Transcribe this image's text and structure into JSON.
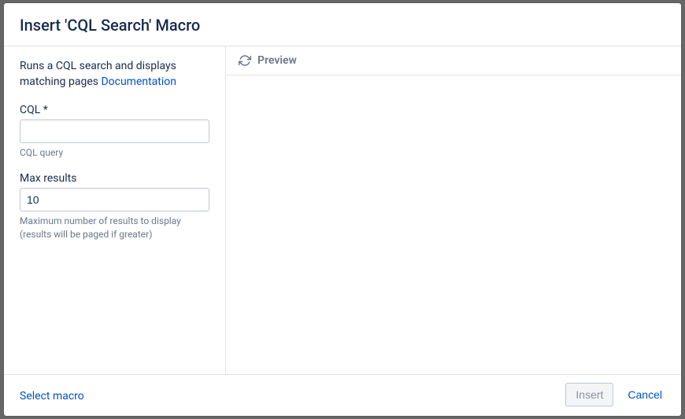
{
  "header": {
    "title": "Insert 'CQL Search' Macro"
  },
  "sidebar": {
    "description_prefix": "Runs a CQL search and displays matching pages ",
    "documentation_link": "Documentation",
    "cql": {
      "label": "CQL *",
      "value": "",
      "hint": "CQL query"
    },
    "max_results": {
      "label": "Max results",
      "value": "10",
      "hint": "Maximum number of results to display (results will be paged if greater)"
    }
  },
  "preview": {
    "title": "Preview"
  },
  "footer": {
    "select_macro": "Select macro",
    "insert": "Insert",
    "cancel": "Cancel"
  }
}
